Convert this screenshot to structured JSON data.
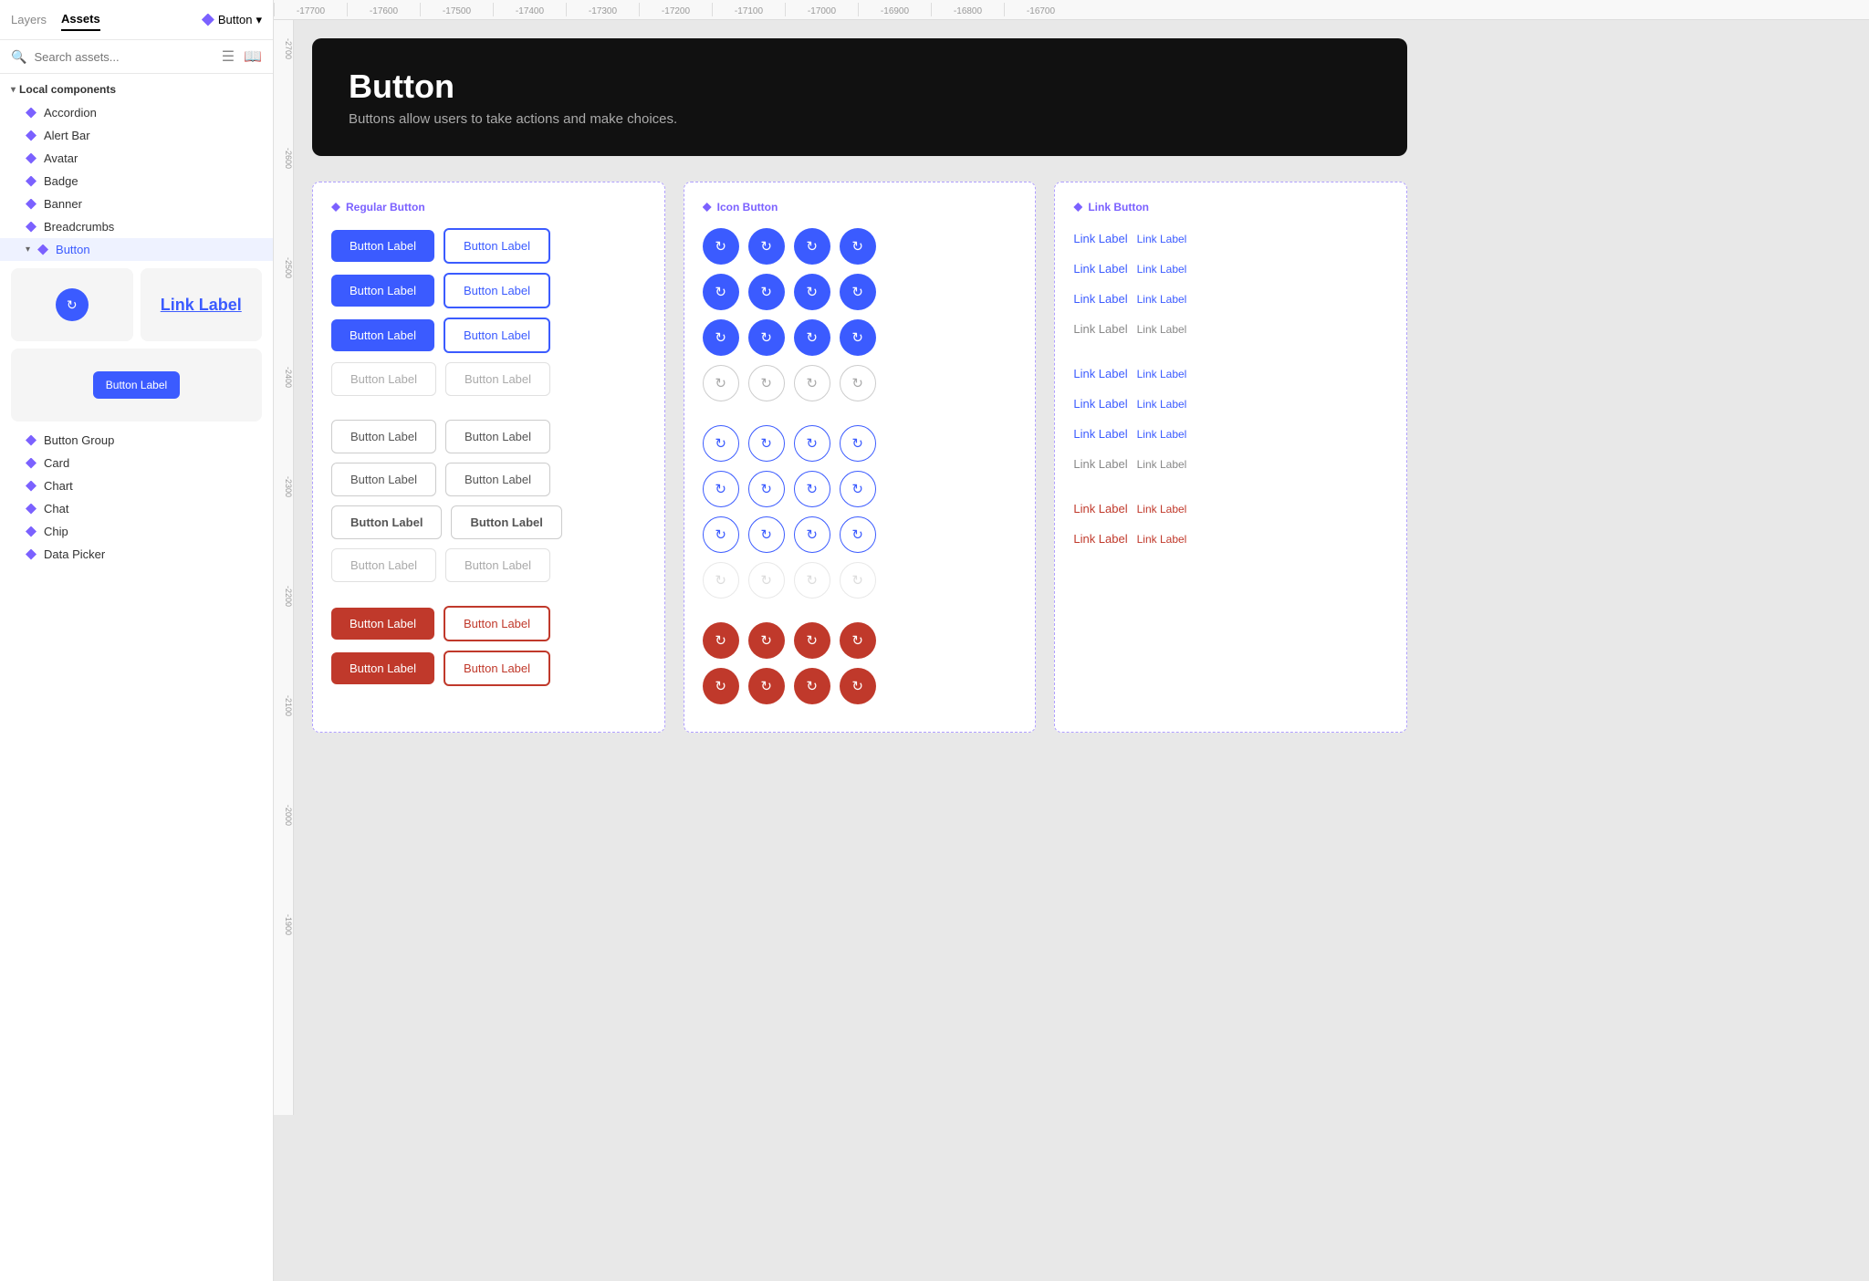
{
  "app": {
    "tabs": [
      {
        "id": "layers",
        "label": "Layers"
      },
      {
        "id": "assets",
        "label": "Assets"
      }
    ],
    "active_tab": "assets",
    "breadcrumb": {
      "icon": "component-icon",
      "label": "Button",
      "chevron": "▾"
    }
  },
  "sidebar": {
    "search_placeholder": "Search assets...",
    "section_label": "Local components",
    "items": [
      {
        "id": "accordion",
        "label": "Accordion"
      },
      {
        "id": "alert-bar",
        "label": "Alert Bar"
      },
      {
        "id": "avatar",
        "label": "Avatar"
      },
      {
        "id": "badge",
        "label": "Badge"
      },
      {
        "id": "banner",
        "label": "Banner"
      },
      {
        "id": "breadcrumbs",
        "label": "Breadcrumbs"
      },
      {
        "id": "button",
        "label": "Button",
        "active": true,
        "expanded": true
      },
      {
        "id": "button-group",
        "label": "Button Group"
      },
      {
        "id": "card",
        "label": "Card"
      },
      {
        "id": "chart",
        "label": "Chart"
      },
      {
        "id": "chat",
        "label": "Chat"
      },
      {
        "id": "chip",
        "label": "Chip"
      },
      {
        "id": "data-picker",
        "label": "Data Picker"
      }
    ],
    "previews": [
      {
        "id": "icon-btn-preview",
        "type": "icon-btn"
      },
      {
        "id": "link-preview",
        "type": "link",
        "label": "Link Label"
      },
      {
        "id": "filled-btn-preview",
        "type": "filled-btn",
        "label": "Button Label"
      }
    ]
  },
  "ruler": {
    "x_ticks": [
      "-17700",
      "-17600",
      "-17500",
      "-17400",
      "-17300",
      "-17200",
      "-17100",
      "-17000",
      "-16900",
      "-16800",
      "-16700"
    ],
    "y_ticks": [
      "-2700",
      "-2600",
      "-2500",
      "-2400",
      "-2300",
      "-2200",
      "-2100",
      "-2000",
      "-1900"
    ]
  },
  "header": {
    "title": "Button",
    "description": "Buttons allow users to take actions and make choices."
  },
  "sections": {
    "regular_button": {
      "label": "Regular Button",
      "rows": [
        {
          "id": "row1",
          "buttons": [
            {
              "label": "Button Label",
              "variant": "filled"
            },
            {
              "label": "Button Label",
              "variant": "filled-outline"
            }
          ]
        },
        {
          "id": "row2",
          "buttons": [
            {
              "label": "Button Label",
              "variant": "filled"
            },
            {
              "label": "Button Label",
              "variant": "filled-outline"
            }
          ]
        },
        {
          "id": "row3",
          "buttons": [
            {
              "label": "Button Label",
              "variant": "filled"
            },
            {
              "label": "Button Label",
              "variant": "filled-outline"
            }
          ]
        },
        {
          "id": "row4",
          "buttons": [
            {
              "label": "Button Label",
              "variant": "ghost"
            },
            {
              "label": "Button Label",
              "variant": "ghost-light"
            }
          ]
        },
        {
          "id": "row5",
          "buttons": [
            {
              "label": "Button Label",
              "variant": "ghost"
            },
            {
              "label": "Button Label",
              "variant": "ghost"
            }
          ]
        },
        {
          "id": "row6",
          "buttons": [
            {
              "label": "Button Label",
              "variant": "ghost"
            },
            {
              "label": "Button Label",
              "variant": "ghost"
            }
          ]
        },
        {
          "id": "row7",
          "buttons": [
            {
              "label": "Button Label",
              "variant": "ghost"
            },
            {
              "label": "Button Label",
              "variant": "ghost"
            }
          ]
        },
        {
          "id": "row8",
          "buttons": [
            {
              "label": "Button Label",
              "variant": "ghost-light"
            },
            {
              "label": "Button Label",
              "variant": "ghost-light"
            }
          ]
        },
        {
          "id": "row-danger1",
          "buttons": [
            {
              "label": "Button Label",
              "variant": "danger"
            },
            {
              "label": "Button Label",
              "variant": "danger-outline"
            }
          ]
        },
        {
          "id": "row-danger2",
          "buttons": [
            {
              "label": "Button Label",
              "variant": "danger"
            },
            {
              "label": "Button Label",
              "variant": "danger-outline"
            }
          ]
        }
      ]
    },
    "icon_button": {
      "label": "Icon Button",
      "rows": [
        {
          "id": "irow1",
          "icons": [
            "blue",
            "blue",
            "blue",
            "blue"
          ]
        },
        {
          "id": "irow2",
          "icons": [
            "blue",
            "blue",
            "blue",
            "blue"
          ]
        },
        {
          "id": "irow3",
          "icons": [
            "blue",
            "blue",
            "blue",
            "blue"
          ]
        },
        {
          "id": "irow4",
          "icons": [
            "ghost",
            "ghost",
            "ghost",
            "ghost"
          ]
        },
        {
          "id": "irow5",
          "icons": [
            "outline",
            "outline",
            "outline",
            "outline"
          ]
        },
        {
          "id": "irow6",
          "icons": [
            "outline",
            "outline",
            "outline",
            "outline"
          ]
        },
        {
          "id": "irow7",
          "icons": [
            "outline",
            "outline",
            "outline",
            "outline"
          ]
        },
        {
          "id": "irow8",
          "icons": [
            "ghost-light",
            "ghost-light",
            "ghost-light",
            "ghost-light"
          ]
        },
        {
          "id": "irow-d1",
          "icons": [
            "danger",
            "danger",
            "danger",
            "danger"
          ]
        },
        {
          "id": "irow-d2",
          "icons": [
            "danger",
            "danger",
            "danger",
            "danger"
          ]
        }
      ]
    },
    "link_button": {
      "label": "Link Button",
      "rows": [
        {
          "id": "lrow1",
          "links": [
            {
              "label": "Link Label",
              "variant": "blue"
            },
            {
              "label": "Link Label",
              "variant": "blue-sm"
            }
          ]
        },
        {
          "id": "lrow2",
          "links": [
            {
              "label": "Link Label",
              "variant": "blue"
            },
            {
              "label": "Link Label",
              "variant": "blue-sm"
            }
          ]
        },
        {
          "id": "lrow3",
          "links": [
            {
              "label": "Link Label",
              "variant": "blue"
            },
            {
              "label": "Link Label",
              "variant": "blue-sm"
            }
          ]
        },
        {
          "id": "lrow4",
          "links": [
            {
              "label": "Link Label",
              "variant": "gray"
            },
            {
              "label": "Link Label",
              "variant": "gray-sm"
            }
          ]
        },
        {
          "id": "lrow5",
          "links": [
            {
              "label": "Link Label",
              "variant": "blue"
            },
            {
              "label": "Link Label",
              "variant": "blue-sm"
            }
          ]
        },
        {
          "id": "lrow6",
          "links": [
            {
              "label": "Link Label",
              "variant": "blue"
            },
            {
              "label": "Link Label",
              "variant": "blue-sm"
            }
          ]
        },
        {
          "id": "lrow7",
          "links": [
            {
              "label": "Link Label",
              "variant": "blue"
            },
            {
              "label": "Link Label",
              "variant": "blue-sm"
            }
          ]
        },
        {
          "id": "lrow8",
          "links": [
            {
              "label": "Link Label",
              "variant": "gray"
            },
            {
              "label": "Link Label",
              "variant": "gray-sm"
            }
          ]
        },
        {
          "id": "lrow-d1",
          "links": [
            {
              "label": "Link Label",
              "variant": "red"
            },
            {
              "label": "Link Label",
              "variant": "red-sm"
            }
          ]
        },
        {
          "id": "lrow-d2",
          "links": [
            {
              "label": "Link Label",
              "variant": "red"
            },
            {
              "label": "Link Label",
              "variant": "red-sm"
            }
          ]
        }
      ]
    }
  }
}
